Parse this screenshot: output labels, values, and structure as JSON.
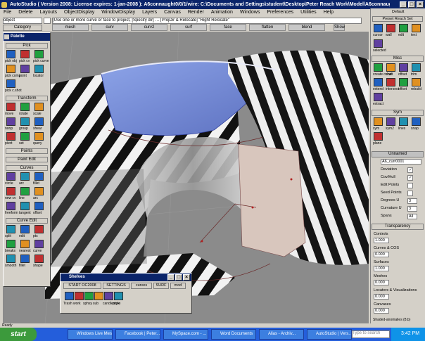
{
  "window": {
    "title": "AutoStudio ( Version 2008: License expires: 1-jan-2008 ): A6connaught0/0/1/wire: C:\\Documents and Settings\\student\\Desktop\\Peter Reach Work\\Model\\A6connaught0/0/1/wire"
  },
  "menu": [
    "File",
    "Delete",
    "Layouts",
    "ObjectDisplay",
    "WindowDisplay",
    "Layers",
    "Canvas",
    "Render",
    "Animation",
    "Windows",
    "Preferences",
    "Utilities",
    "Help"
  ],
  "toolbar": {
    "object_field": "object",
    "category_label": "Category",
    "command_field": "[Use one or more curve or face to project, [Specify dir] … [ProjDir & Relocate] \"Right Relocate\"",
    "view_tabs": [
      "mesh",
      "curv",
      "curv2",
      "surf",
      "face",
      "flatten",
      "blend"
    ],
    "show_label": "Show",
    "counter": "1"
  },
  "palette": {
    "title": "Palette",
    "sections": [
      {
        "name": "Pick",
        "tools": [
          "pick obj",
          "pick cv",
          "pick curve",
          "pick comp",
          "point",
          "locator",
          "pick c.shot"
        ]
      },
      {
        "name": "Transform",
        "tools": [
          "move",
          "rotate",
          "scale",
          "nonp",
          "group",
          "shear",
          "pivot",
          "set",
          "query"
        ]
      },
      {
        "name": "Points",
        "tools": []
      },
      {
        "name": "Paint Edit",
        "tools": []
      },
      {
        "name": "Curves",
        "tools": [
          "circle",
          "arc",
          "fillet",
          "new cv",
          "line",
          "arc",
          "freeform",
          "tangent",
          "offset"
        ]
      },
      {
        "name": "Curve Edit",
        "tools": [
          "split",
          "edit",
          "pts",
          "breaks",
          "nearest",
          "curve",
          "smooth",
          "fillet",
          "shape"
        ]
      }
    ]
  },
  "right_panel": {
    "header": "Default",
    "tabs": [
      "Preset Reach Set"
    ],
    "top_tools": [
      "cursor",
      "wall",
      "edit",
      "text",
      "selected"
    ],
    "sections": [
      {
        "name": "Misc",
        "tools": [
          "create curve",
          "draft",
          "offset",
          "trim",
          "extend",
          "intersect",
          "offset",
          "rebuild",
          "extract"
        ]
      },
      {
        "name": "Sym",
        "tools": [
          "sym",
          "sym2",
          "lines",
          "snap",
          "plane"
        ]
      }
    ],
    "draw_pane": "Unnamed",
    "draw_field": "A6_curr0001",
    "checkboxes": [
      {
        "label": "Deviation",
        "checked": true
      },
      {
        "label": "Cov/Hull",
        "checked": true
      },
      {
        "label": "Edit Points",
        "checked": false
      },
      {
        "label": "Seed Points",
        "checked": false
      },
      {
        "label": "Degrees U",
        "value": "3"
      },
      {
        "label": "Curvature U",
        "value": "3"
      },
      {
        "label": "Spans",
        "value": "All"
      }
    ],
    "transparency_label": "Transparency",
    "fields": [
      {
        "label": "Controls",
        "value": "1.000"
      },
      {
        "label": "Curves & COS",
        "value": "0.000"
      },
      {
        "label": "Surfaces",
        "value": "1.000"
      },
      {
        "label": "Meshes",
        "value": "0.000"
      },
      {
        "label": "Locators & Visualizations",
        "value": "0.000"
      },
      {
        "label": "Canvases",
        "value": "0.000"
      }
    ],
    "footer": "Shaded-anomalies (8.b)"
  },
  "shelves": {
    "title": "Shelves",
    "tabs": [
      "START OC2008",
      "SETTINGS",
      "curves",
      "SURF",
      "mod"
    ],
    "items": [
      "Trash",
      "work",
      "sphsy",
      "sub",
      "candlestyle",
      "proxi"
    ]
  },
  "status_bar": {
    "text": "Ready"
  },
  "taskbar": {
    "start": "start",
    "items": [
      "Windows Live Mes...",
      "Facebook | Peter...",
      "MySpace.com - ...",
      "Word Documents",
      "Alias - Archiv...",
      "AutoStudio | Vers..."
    ],
    "search_placeholder": "Type to search",
    "clock": "3:42 PM"
  },
  "colors": {
    "title_bar": "#0a246a",
    "taskbar": "#245edb",
    "panel": "#d4d0c8",
    "start_button": "#3c9a3c",
    "viewport": "#8a8a8a"
  }
}
